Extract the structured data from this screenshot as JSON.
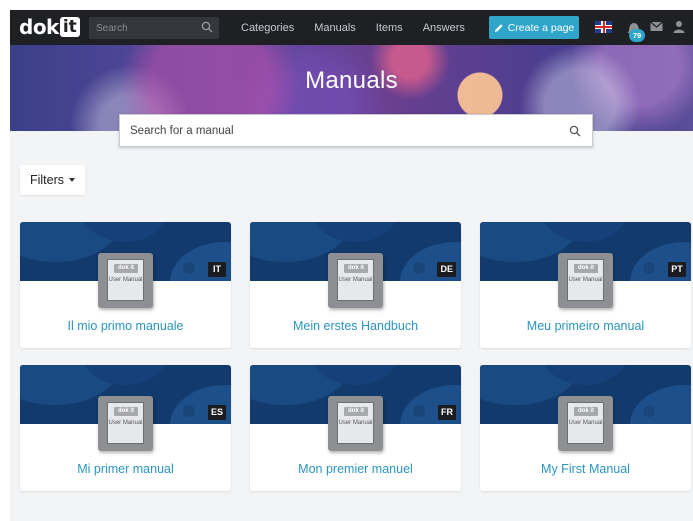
{
  "header": {
    "logo_text": "dok",
    "logo_badge": "it",
    "search_placeholder": "Search",
    "nav": [
      "Categories",
      "Manuals",
      "Items",
      "Answers"
    ],
    "create_label": "Create a page",
    "notification_count": "79"
  },
  "hero": {
    "title": "Manuals",
    "search_placeholder": "Search for a manual"
  },
  "filters_label": "Filters",
  "manuals": [
    {
      "title": "Il mio primo manuale",
      "lang": "IT",
      "cover_logo": "dok it",
      "cover_text": "User Manual"
    },
    {
      "title": "Mein erstes Handbuch",
      "lang": "DE",
      "cover_logo": "dok it",
      "cover_text": "User Manual"
    },
    {
      "title": "Meu primeiro manual",
      "lang": "PT",
      "cover_logo": "dok it",
      "cover_text": "User Manual"
    },
    {
      "title": "Mi primer manual",
      "lang": "ES",
      "cover_logo": "dok it",
      "cover_text": "User Manual"
    },
    {
      "title": "Mon premier manuel",
      "lang": "FR",
      "cover_logo": "dok it",
      "cover_text": "User Manual"
    },
    {
      "title": "My First Manual",
      "lang": "",
      "cover_logo": "dok it",
      "cover_text": "User Manual"
    }
  ],
  "colors": {
    "topbar": "#1f2024",
    "accent": "#2ea5c9",
    "card_header": "#123a6d",
    "card_title": "#2a95bf"
  }
}
